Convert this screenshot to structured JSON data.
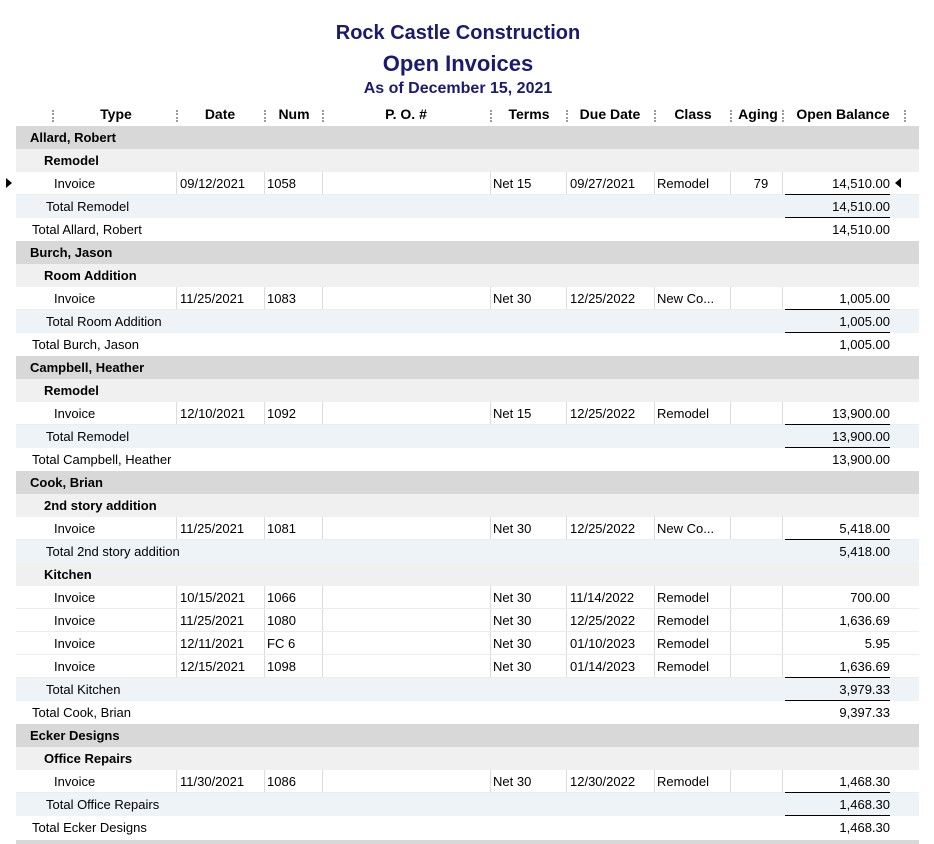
{
  "report": {
    "company": "Rock Castle Construction",
    "title": "Open Invoices",
    "as_of": "As of December 15, 2021"
  },
  "columns": {
    "type": "Type",
    "date": "Date",
    "num": "Num",
    "po": "P. O. #",
    "terms": "Terms",
    "due": "Due Date",
    "class": "Class",
    "aging": "Aging",
    "balance": "Open Balance"
  },
  "rows": [
    {
      "kind": "group",
      "label": "Allard, Robert"
    },
    {
      "kind": "sub",
      "label": "Remodel"
    },
    {
      "kind": "txn",
      "type": "Invoice",
      "date": "09/12/2021",
      "num": "1058",
      "po": "",
      "terms": "Net 15",
      "due": "09/27/2021",
      "class": "Remodel",
      "aging": "79",
      "balance": "14,510.00",
      "underline": true
    },
    {
      "kind": "subtotal",
      "label": "Total Remodel",
      "balance": "14,510.00",
      "underline": true
    },
    {
      "kind": "total",
      "label": "Total Allard, Robert",
      "balance": "14,510.00"
    },
    {
      "kind": "group",
      "label": "Burch, Jason"
    },
    {
      "kind": "sub",
      "label": "Room Addition"
    },
    {
      "kind": "txn",
      "type": "Invoice",
      "date": "11/25/2021",
      "num": "1083",
      "po": "",
      "terms": "Net 30",
      "due": "12/25/2022",
      "class": "New Co...",
      "aging": "",
      "balance": "1,005.00",
      "underline": true
    },
    {
      "kind": "subtotal",
      "label": "Total Room Addition",
      "balance": "1,005.00",
      "underline": true
    },
    {
      "kind": "total",
      "label": "Total Burch, Jason",
      "balance": "1,005.00"
    },
    {
      "kind": "group",
      "label": "Campbell, Heather"
    },
    {
      "kind": "sub",
      "label": "Remodel"
    },
    {
      "kind": "txn",
      "type": "Invoice",
      "date": "12/10/2021",
      "num": "1092",
      "po": "",
      "terms": "Net 15",
      "due": "12/25/2022",
      "class": "Remodel",
      "aging": "",
      "balance": "13,900.00",
      "underline": true
    },
    {
      "kind": "subtotal",
      "label": "Total Remodel",
      "balance": "13,900.00",
      "underline": true
    },
    {
      "kind": "total",
      "label": "Total Campbell, Heather",
      "balance": "13,900.00"
    },
    {
      "kind": "group",
      "label": "Cook, Brian"
    },
    {
      "kind": "sub",
      "label": "2nd story addition"
    },
    {
      "kind": "txn",
      "type": "Invoice",
      "date": "11/25/2021",
      "num": "1081",
      "po": "",
      "terms": "Net 30",
      "due": "12/25/2022",
      "class": "New Co...",
      "aging": "",
      "balance": "5,418.00",
      "underline": true
    },
    {
      "kind": "subtotal",
      "label": "Total 2nd story addition",
      "balance": "5,418.00"
    },
    {
      "kind": "sub",
      "label": "Kitchen"
    },
    {
      "kind": "txn",
      "type": "Invoice",
      "date": "10/15/2021",
      "num": "1066",
      "po": "",
      "terms": "Net 30",
      "due": "11/14/2022",
      "class": "Remodel",
      "aging": "",
      "balance": "700.00"
    },
    {
      "kind": "txn",
      "type": "Invoice",
      "date": "11/25/2021",
      "num": "1080",
      "po": "",
      "terms": "Net 30",
      "due": "12/25/2022",
      "class": "Remodel",
      "aging": "",
      "balance": "1,636.69"
    },
    {
      "kind": "txn",
      "type": "Invoice",
      "date": "12/11/2021",
      "num": "FC 6",
      "po": "",
      "terms": "Net 30",
      "due": "01/10/2023",
      "class": "Remodel",
      "aging": "",
      "balance": "5.95"
    },
    {
      "kind": "txn",
      "type": "Invoice",
      "date": "12/15/2021",
      "num": "1098",
      "po": "",
      "terms": "Net 30",
      "due": "01/14/2023",
      "class": "Remodel",
      "aging": "",
      "balance": "1,636.69",
      "underline": true
    },
    {
      "kind": "subtotal",
      "label": "Total Kitchen",
      "balance": "3,979.33",
      "underline": true
    },
    {
      "kind": "total",
      "label": "Total Cook, Brian",
      "balance": "9,397.33"
    },
    {
      "kind": "group",
      "label": "Ecker Designs"
    },
    {
      "kind": "sub",
      "label": "Office Repairs"
    },
    {
      "kind": "txn",
      "type": "Invoice",
      "date": "11/30/2021",
      "num": "1086",
      "po": "",
      "terms": "Net 30",
      "due": "12/30/2022",
      "class": "Remodel",
      "aging": "",
      "balance": "1,468.30",
      "underline": true
    },
    {
      "kind": "subtotal",
      "label": "Total Office Repairs",
      "balance": "1,468.30",
      "underline": true
    },
    {
      "kind": "total",
      "label": "Total Ecker Designs",
      "balance": "1,468.30"
    }
  ]
}
